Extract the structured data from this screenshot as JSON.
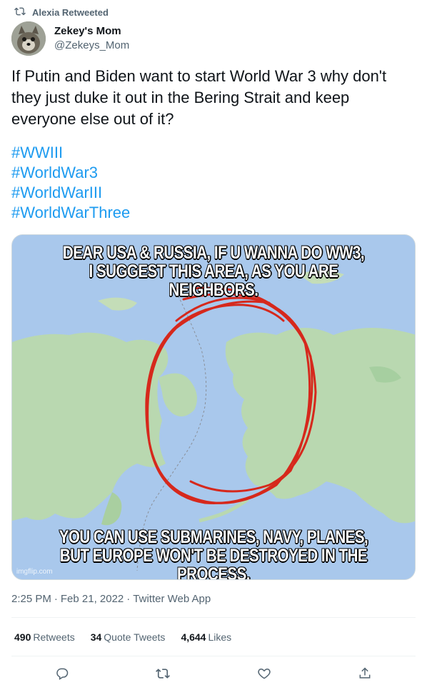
{
  "retweet_context": {
    "text": "Alexia Retweeted",
    "icon": "retweet-icon"
  },
  "author": {
    "display_name": "Zekey's Mom",
    "handle": "@Zekeys_Mom"
  },
  "tweet": {
    "text": "If Putin and Biden want to start World War 3 why don't they just duke it out in the Bering Strait and keep everyone else out of it?",
    "hashtags": [
      "#WWIII",
      "#WorldWar3",
      "#WorldWarIII",
      "#WorldWarThree"
    ]
  },
  "media": {
    "top_text_1": "DEAR USA & RUSSIA, IF U WANNA DO WW3,",
    "top_text_2": "I SUGGEST THIS AREA, AS YOU ARE NEIGHBORS.",
    "bottom_text_1": "YOU CAN USE SUBMARINES, NAVY, PLANES,",
    "bottom_text_2": "BUT EUROPE WON'T BE DESTROYED IN THE PROCESS.",
    "watermark": "imgflip.com"
  },
  "meta": {
    "time": "2:25 PM",
    "date": "Feb 21, 2022",
    "client": "Twitter Web App",
    "sep": "·"
  },
  "stats": {
    "retweets_count": "490",
    "retweets_label": "Retweets",
    "quotes_count": "34",
    "quotes_label": "Quote Tweets",
    "likes_count": "4,644",
    "likes_label": "Likes"
  },
  "colors": {
    "link": "#1d9bf0",
    "secondary": "#536471",
    "ocean": "#a9c8ec",
    "land": "#b9d8b0",
    "circle": "#d6281c"
  }
}
